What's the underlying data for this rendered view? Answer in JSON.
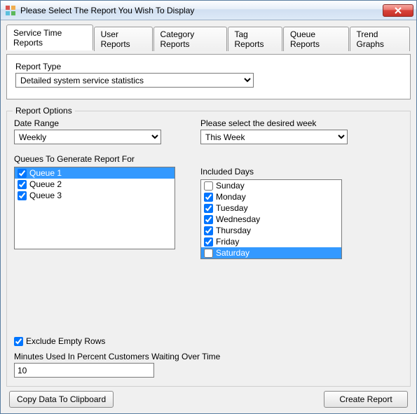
{
  "window": {
    "title": "Please Select The Report You Wish To Display"
  },
  "tabs": [
    {
      "label": "Service Time Reports",
      "active": true
    },
    {
      "label": "User Reports",
      "active": false
    },
    {
      "label": "Category Reports",
      "active": false
    },
    {
      "label": "Tag Reports",
      "active": false
    },
    {
      "label": "Queue Reports",
      "active": false
    },
    {
      "label": "Trend Graphs",
      "active": false
    }
  ],
  "report_type": {
    "label": "Report Type",
    "value": "Detailed system service statistics"
  },
  "report_options": {
    "title": "Report Options",
    "date_range": {
      "label": "Date Range",
      "value": "Weekly"
    },
    "week_select": {
      "label": "Please select the desired week",
      "value": "This Week"
    },
    "queues": {
      "label": "Queues To Generate Report For",
      "items": [
        {
          "label": "Queue 1",
          "checked": true,
          "selected": true
        },
        {
          "label": "Queue 2",
          "checked": true,
          "selected": false
        },
        {
          "label": "Queue 3",
          "checked": true,
          "selected": false
        }
      ]
    },
    "days": {
      "label": "Included Days",
      "items": [
        {
          "label": "Sunday",
          "checked": false,
          "selected": false
        },
        {
          "label": "Monday",
          "checked": true,
          "selected": false
        },
        {
          "label": "Tuesday",
          "checked": true,
          "selected": false
        },
        {
          "label": "Wednesday",
          "checked": true,
          "selected": false
        },
        {
          "label": "Thursday",
          "checked": true,
          "selected": false
        },
        {
          "label": "Friday",
          "checked": true,
          "selected": false
        },
        {
          "label": "Saturday",
          "checked": false,
          "selected": true
        }
      ]
    },
    "exclude_empty": {
      "label": "Exclude Empty Rows",
      "checked": true
    },
    "minutes_field": {
      "label": "Minutes Used In Percent Customers Waiting Over Time",
      "value": "10"
    }
  },
  "buttons": {
    "clipboard": "Copy Data To Clipboard",
    "create": "Create Report"
  }
}
